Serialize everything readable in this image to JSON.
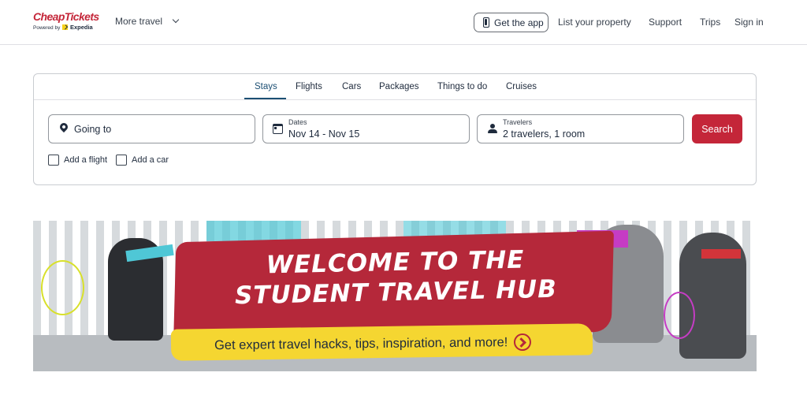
{
  "header": {
    "logo_text": "CheapTickets",
    "logo_powered_by": "Powered by",
    "logo_partner": "Expedia",
    "more_travel": "More travel",
    "get_app": "Get the app",
    "list_property": "List your property",
    "support": "Support",
    "trips": "Trips",
    "sign_in": "Sign in"
  },
  "search": {
    "tabs": [
      {
        "label": "Stays",
        "active": true
      },
      {
        "label": "Flights",
        "active": false
      },
      {
        "label": "Cars",
        "active": false
      },
      {
        "label": "Packages",
        "active": false
      },
      {
        "label": "Things to do",
        "active": false
      },
      {
        "label": "Cruises",
        "active": false
      }
    ],
    "going_to_placeholder": "Going to",
    "dates_label": "Dates",
    "dates_value": "Nov 14 - Nov 15",
    "travelers_label": "Travelers",
    "travelers_value": "2 travelers, 1 room",
    "search_button": "Search",
    "add_flight": "Add a flight",
    "add_car": "Add a car"
  },
  "banner": {
    "headline_line1": "WELCOME TO THE",
    "headline_line2": "STUDENT TRAVEL HUB",
    "subline": "Get expert travel hacks, tips, inspiration, and more!"
  },
  "colors": {
    "brand_red": "#c42639",
    "tab_active": "#1c4f73",
    "banner_red": "#b5283a",
    "banner_yellow": "#f5d631"
  }
}
